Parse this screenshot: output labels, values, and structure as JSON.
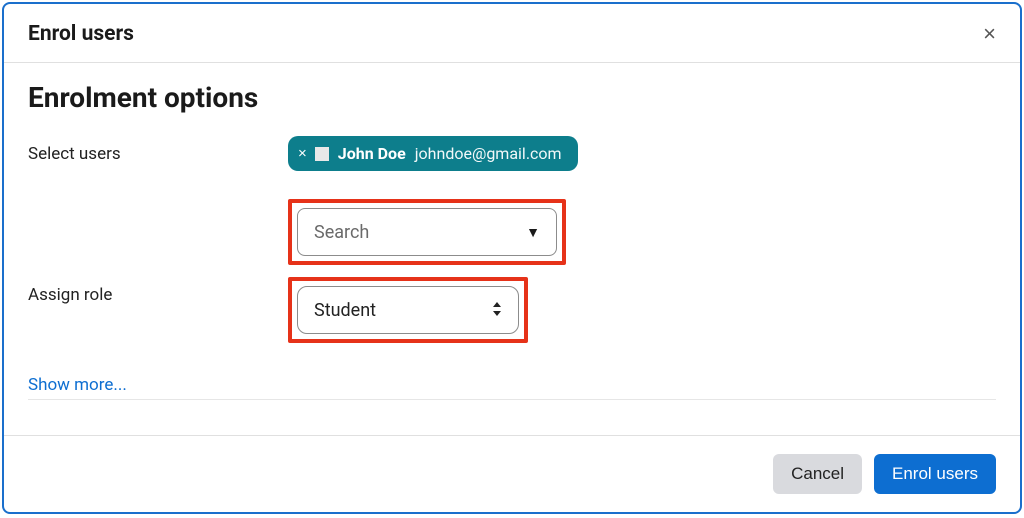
{
  "dialog": {
    "title": "Enrol users",
    "section_title": "Enrolment options",
    "close_symbol": "×"
  },
  "form": {
    "select_users_label": "Select users",
    "assign_role_label": "Assign role",
    "show_more_label": "Show more..."
  },
  "selected_user": {
    "name": "John Doe",
    "email": "johndoe@gmail.com",
    "remove_symbol": "×"
  },
  "search": {
    "placeholder": "Search",
    "caret": "▼"
  },
  "role_select": {
    "value": "Student",
    "caret": "⇕"
  },
  "footer": {
    "cancel_label": "Cancel",
    "submit_label": "Enrol users"
  }
}
